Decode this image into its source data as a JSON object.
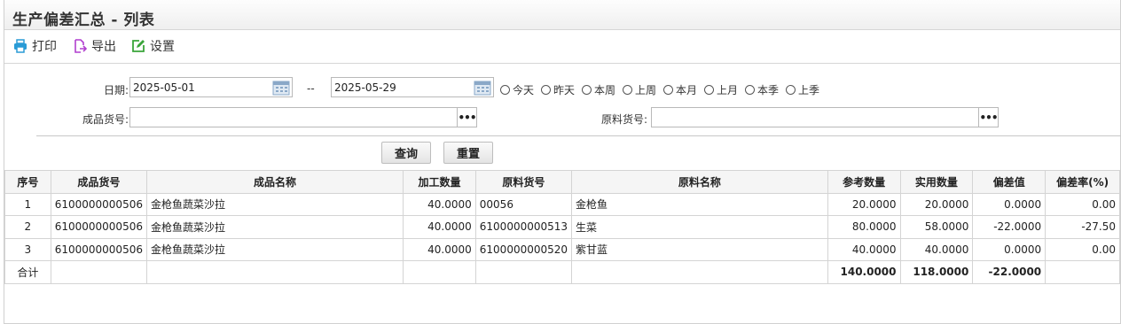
{
  "page": {
    "title": "生产偏差汇总 - 列表"
  },
  "toolbar": {
    "print_label": "打印",
    "export_label": "导出",
    "settings_label": "设置"
  },
  "filters": {
    "date_label": "日期:",
    "date_from": "2025-05-01",
    "date_separator": "--",
    "date_to": "2025-05-29",
    "quick_ranges": [
      "今天",
      "昨天",
      "本周",
      "上周",
      "本月",
      "上月",
      "本季",
      "上季"
    ],
    "product_code_label": "成品货号:",
    "product_code_value": "",
    "material_code_label": "原料货号:",
    "material_code_value": "",
    "picker_label": "•••",
    "query_label": "查询",
    "reset_label": "重置"
  },
  "table": {
    "columns": [
      "序号",
      "成品货号",
      "成品名称",
      "加工数量",
      "原料货号",
      "原料名称",
      "参考数量",
      "实用数量",
      "偏差值",
      "偏差率(%)"
    ],
    "rows": [
      [
        "1",
        "6100000000506",
        "金枪鱼蔬菜沙拉",
        "40.0000",
        "00056",
        "金枪鱼",
        "20.0000",
        "20.0000",
        "0.0000",
        "0.00"
      ],
      [
        "2",
        "6100000000506",
        "金枪鱼蔬菜沙拉",
        "40.0000",
        "6100000000513",
        "生菜",
        "80.0000",
        "58.0000",
        "-22.0000",
        "-27.50"
      ],
      [
        "3",
        "6100000000506",
        "金枪鱼蔬菜沙拉",
        "40.0000",
        "6100000000520",
        "紫甘蓝",
        "40.0000",
        "40.0000",
        "0.0000",
        "0.00"
      ]
    ],
    "total": {
      "label": "合计",
      "ref_qty": "140.0000",
      "actual_qty": "118.0000",
      "deviation": "-22.0000"
    }
  },
  "colors": {
    "print_icon": "#2a9bd6",
    "export_icon": "#b13fcf",
    "settings_icon": "#3aa53a",
    "calendar_icon": "#8aa8c8"
  }
}
